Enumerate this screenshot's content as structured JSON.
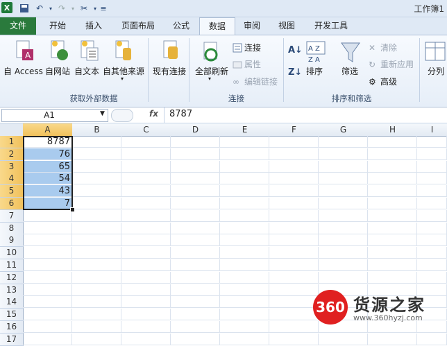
{
  "app": {
    "window_title": "工作簿1"
  },
  "tabs": [
    "文件",
    "开始",
    "插入",
    "页面布局",
    "公式",
    "数据",
    "审阅",
    "视图",
    "开发工具"
  ],
  "ribbon": {
    "groups": {
      "external_data": "获取外部数据",
      "connections": "连接",
      "sort_filter": "排序和筛选"
    },
    "buttons": {
      "from_access": "自 Access",
      "from_web": "自网站",
      "from_text": "自文本",
      "from_other": "自其他来源",
      "existing_conn": "现有连接",
      "refresh_all": "全部刷新",
      "connections": "连接",
      "properties": "属性",
      "edit_links": "编辑链接",
      "sort": "排序",
      "filter": "筛选",
      "clear": "清除",
      "reapply": "重新应用",
      "advanced": "高级",
      "split": "分列"
    }
  },
  "formula_bar": {
    "name_box": "A1",
    "fx": "fx",
    "value": "8787"
  },
  "sheet": {
    "columns": [
      "A",
      "B",
      "C",
      "D",
      "E",
      "F",
      "G",
      "H",
      "I"
    ],
    "rows": [
      "1",
      "2",
      "3",
      "4",
      "5",
      "6",
      "7",
      "8",
      "9",
      "10",
      "11",
      "12",
      "13",
      "14",
      "15",
      "16",
      "17"
    ],
    "colA_values": [
      "8787",
      "76",
      "65",
      "54",
      "43",
      "7"
    ]
  },
  "watermark": {
    "badge": "360",
    "name": "货源之家",
    "url": "www.360hyzj.com"
  },
  "colors": {
    "file_tab": "#2a7a3c",
    "selection_fill": "#a9cbee",
    "watermark_red": "#e02020"
  }
}
